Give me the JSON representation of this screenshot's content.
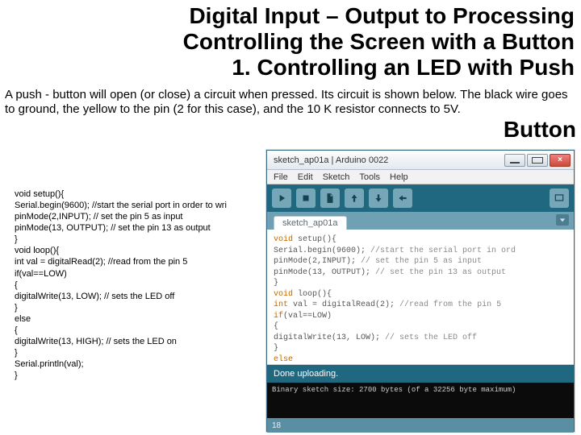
{
  "titles": {
    "line1": "Digital Input – Output to Processing",
    "line2": "Controlling the Screen with a Button",
    "line3": "1. Controlling an LED with Push"
  },
  "big_word": "Button",
  "paragraph": "A push - button will open (or close) a circuit when pressed. Its circuit is shown below. The black wire goes to ground, the yellow to the pin (2 for this case), and the 10 K resistor connects to 5V.",
  "code_lines": [
    "void setup(){",
    "Serial.begin(9600); //start the serial port in order to wri",
    "pinMode(2,INPUT); // set the pin 5 as input",
    "pinMode(13, OUTPUT); // set the pin 13 as output",
    "}",
    "void loop(){",
    "int val = digitalRead(2); //read from the pin 5",
    "if(val==LOW)",
    "{",
    "digitalWrite(13, LOW); // sets the LED off",
    "}",
    "else",
    "{",
    "digitalWrite(13, HIGH); // sets the LED on",
    "}",
    "Serial.println(val);",
    "}"
  ],
  "arduino": {
    "window_title": "sketch_ap01a | Arduino 0022",
    "menus": [
      "File",
      "Edit",
      "Sketch",
      "Tools",
      "Help"
    ],
    "tab_name": "sketch_ap01a",
    "editor_lines": [
      "void setup(){",
      "Serial.begin(9600); //start the serial port in ord",
      "pinMode(2,INPUT); // set the pin 5 as input",
      "pinMode(13, OUTPUT); // set the pin 13 as output",
      "}",
      "void loop(){",
      "int val = digitalRead(2); //read from the pin 5",
      "if(val==LOW)",
      "{",
      "digitalWrite(13, LOW); // sets the LED off",
      "}",
      "else",
      "{",
      "digitalWrite(13, HIGH); // sets the LED on"
    ],
    "status": "Done uploading.",
    "console_line": "Binary sketch size: 2700 bytes (of a 32256 byte maximum)",
    "footer": "18"
  }
}
